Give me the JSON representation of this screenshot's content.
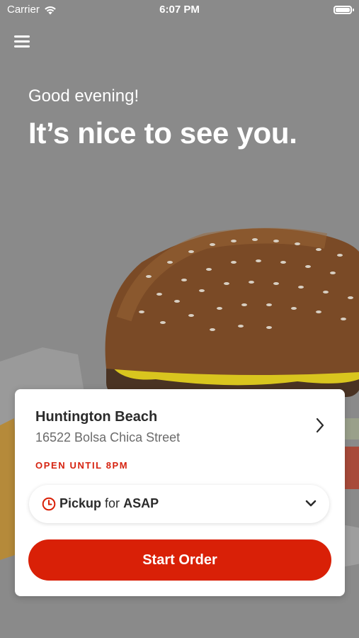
{
  "status_bar": {
    "carrier": "Carrier",
    "time": "6:07 PM"
  },
  "greeting": {
    "subtitle": "Good evening!",
    "headline": "It’s nice to see you."
  },
  "store": {
    "name": "Huntington Beach",
    "address": "16522 Bolsa Chica Street",
    "status": "OPEN UNTIL 8PM"
  },
  "order_mode": {
    "mode": "Pickup",
    "connector": "for",
    "time": "ASAP"
  },
  "start_order": {
    "label": "Start Order"
  },
  "colors": {
    "accent": "#d92007",
    "overlay": "#8a8a8a",
    "card": "#ffffff"
  },
  "icons": [
    "wifi-icon",
    "battery-icon",
    "menu-icon",
    "chevron-right-icon",
    "clock-icon",
    "chevron-down-icon"
  ]
}
